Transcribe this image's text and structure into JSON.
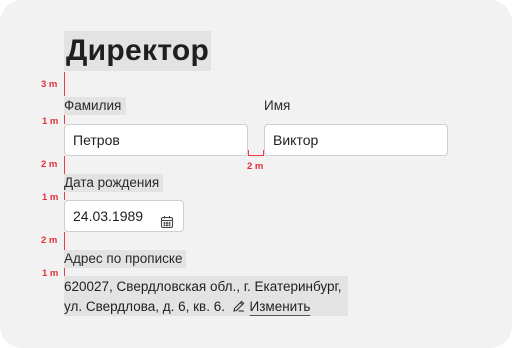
{
  "title": "Директор",
  "fields": {
    "last_name": {
      "label": "Фамилия",
      "value": "Петров"
    },
    "first_name": {
      "label": "Имя",
      "value": "Виктор"
    },
    "birth_date": {
      "label": "Дата рождения",
      "value": "24.03.1989",
      "icon": "calendar-icon"
    },
    "address": {
      "label": "Адрес по прописке",
      "line1": "620027, Свердловская обл., г. Екатеринбург,",
      "line2": "ул. Свердлова, д. 6, кв. 6.",
      "edit_icon": "pencil-icon",
      "edit_label": "Изменить"
    }
  },
  "spacing_markers": {
    "after_title": "3 m",
    "before_name_inputs": "1 m",
    "after_name_inputs": "2 m",
    "between_name_inputs": "2 m",
    "before_date_input": "1 m",
    "after_date_input": "2 m",
    "before_address": "1 m"
  },
  "colors": {
    "card_bg": "#f2f2f2",
    "highlight": "#e3e3e3",
    "marker": "#e0323c"
  }
}
